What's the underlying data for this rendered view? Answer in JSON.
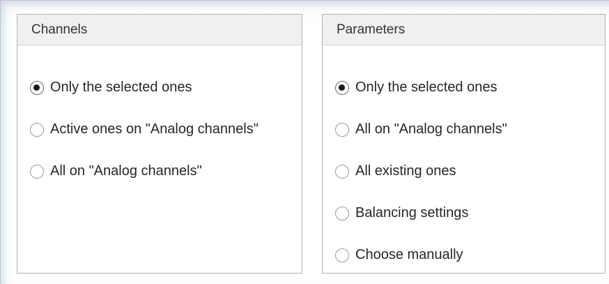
{
  "channels": {
    "title": "Channels",
    "options": [
      {
        "label": "Only the selected ones",
        "checked": true
      },
      {
        "label": "Active ones on \"Analog channels\"",
        "checked": false
      },
      {
        "label": "All on \"Analog channels\"",
        "checked": false
      }
    ]
  },
  "parameters": {
    "title": "Parameters",
    "options": [
      {
        "label": "Only the selected ones",
        "checked": true
      },
      {
        "label": "All on \"Analog channels\"",
        "checked": false
      },
      {
        "label": "All existing ones",
        "checked": false
      },
      {
        "label": "Balancing settings",
        "checked": false
      },
      {
        "label": "Choose manually",
        "checked": false
      }
    ]
  }
}
